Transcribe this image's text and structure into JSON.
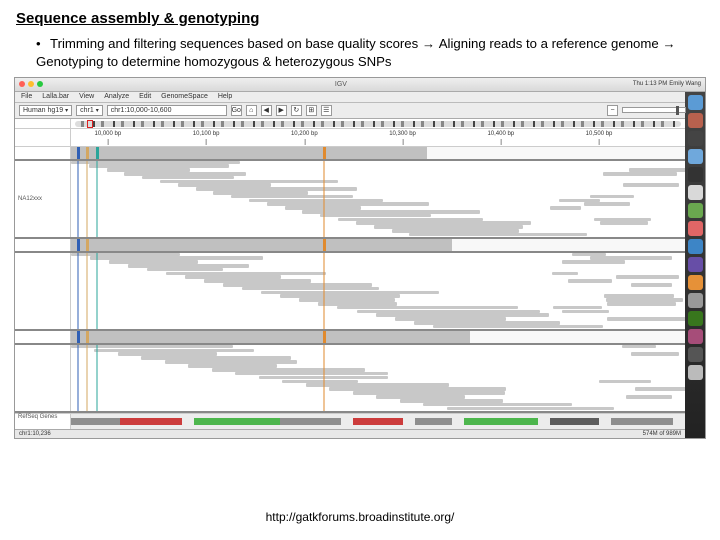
{
  "slide": {
    "title": "Sequence assembly & genotyping",
    "bullet": {
      "part1": "Trimming and filtering sequences based on base quality scores",
      "arrow1": " → ",
      "part2": "Aligning reads to a reference genome",
      "arrow2": " → ",
      "part3": "Genotyping to determine homozygous & heterozygous SNPs"
    },
    "citation": "http://gatkforums.broadinstitute.org/"
  },
  "mac": {
    "window_title": "IGV",
    "clock": "Thu 1:13 PM",
    "user": "Emily Wang"
  },
  "igv": {
    "menu": [
      "File",
      "Lalla.bar",
      "View",
      "Analyze",
      "Edit",
      "GenomeSpace",
      "Help"
    ],
    "toolbar": {
      "genome": "Human hg19",
      "locus": "chr1",
      "region": "chr1:10,000-10,600",
      "go": "Go",
      "home_icon": "⌂",
      "back_icon": "◀",
      "fwd_icon": "▶",
      "refresh_icon": "↻",
      "zoom_minus": "−",
      "zoom_plus": "+"
    },
    "ruler_ticks": [
      {
        "pos": 6,
        "label": "10,000 bp"
      },
      {
        "pos": 22,
        "label": "10,100 bp"
      },
      {
        "pos": 38,
        "label": "10,200 bp"
      },
      {
        "pos": 54,
        "label": "10,300 bp"
      },
      {
        "pos": 70,
        "label": "10,400 bp"
      },
      {
        "pos": 86,
        "label": "10,500 bp"
      }
    ],
    "track_labels": {
      "coverage": "",
      "sample1": "NA12xxx",
      "sample2": "",
      "sample3": "",
      "refseq": "RefSeq Genes"
    },
    "status_left": "chr1:10,236",
    "status_right": "574M of 989M"
  }
}
